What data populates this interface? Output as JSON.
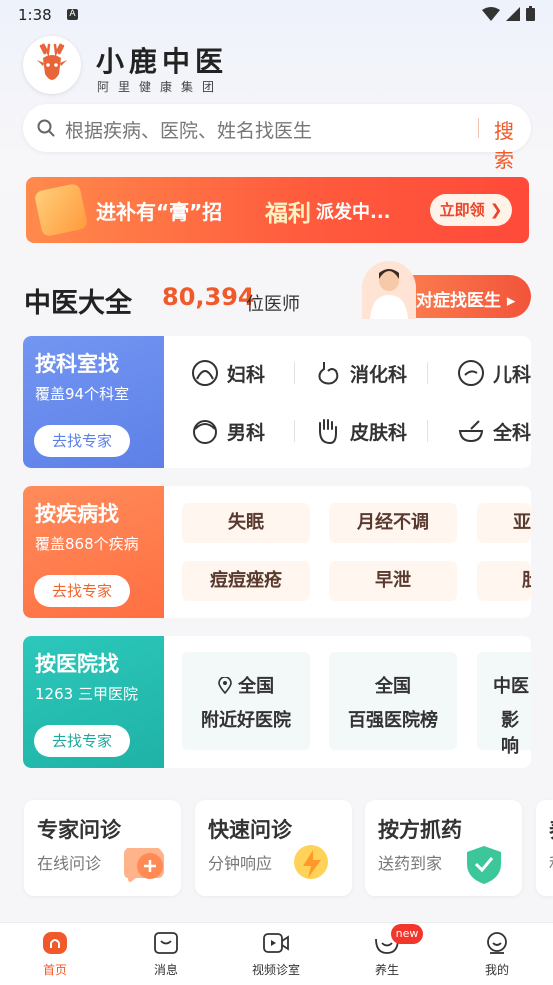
{
  "status": {
    "time": "1:38"
  },
  "brand": {
    "title": "小鹿中医",
    "subtitle": "阿里健康集团"
  },
  "search": {
    "placeholder": "根据疾病、医院、姓名找医生",
    "button": "搜索"
  },
  "banner": {
    "text1": "进补有“膏”招",
    "text2": "福利",
    "text3": "派发中...",
    "cta": "立即领"
  },
  "section": {
    "title": "中医大全",
    "count": "80,394",
    "unit": "位医师",
    "symptom_button": "对症找医生"
  },
  "dept_card": {
    "title": "按科室找",
    "subtitle": "覆盖94个科室",
    "button": "去找专家",
    "items": [
      {
        "label": "妇科",
        "icon": "woman-icon"
      },
      {
        "label": "消化科",
        "icon": "stomach-icon"
      },
      {
        "label": "儿科",
        "icon": "child-icon"
      },
      {
        "label": "男科",
        "icon": "man-icon"
      },
      {
        "label": "皮肤科",
        "icon": "hand-icon"
      },
      {
        "label": "全科",
        "icon": "bowl-icon"
      }
    ]
  },
  "disease_card": {
    "title": "按疾病找",
    "subtitle": "覆盖868个疾病",
    "button": "去找专家",
    "chips": [
      "失眠",
      "月经不调",
      "亚",
      "痘痘痤疮",
      "早泄",
      "肚"
    ]
  },
  "hospital_card": {
    "title": "按医院找",
    "subtitle": "1263 三甲医院",
    "button": "去找专家",
    "items": [
      {
        "line1": "全国",
        "line2": "附近好医院"
      },
      {
        "line1": "全国",
        "line2": "百强医院榜"
      },
      {
        "line1": "中医",
        "line2": "影响"
      }
    ]
  },
  "services": [
    {
      "title": "专家问诊",
      "subtitle": "在线问诊"
    },
    {
      "title": "快速问诊",
      "subtitle": "分钟响应"
    },
    {
      "title": "按方抓药",
      "subtitle": "送药到家"
    },
    {
      "title": "养",
      "subtitle": "和"
    }
  ],
  "tabs": [
    {
      "label": "首页"
    },
    {
      "label": "消息"
    },
    {
      "label": "视频诊室"
    },
    {
      "label": "养生"
    },
    {
      "label": "我的"
    }
  ],
  "tab_badge": "new",
  "colors": {
    "accent": "#f05a2a",
    "dept": "#6d8ff0",
    "disease": "#ff7a4a",
    "hospital": "#27bdb1",
    "tab_active": "#f05a2a"
  }
}
